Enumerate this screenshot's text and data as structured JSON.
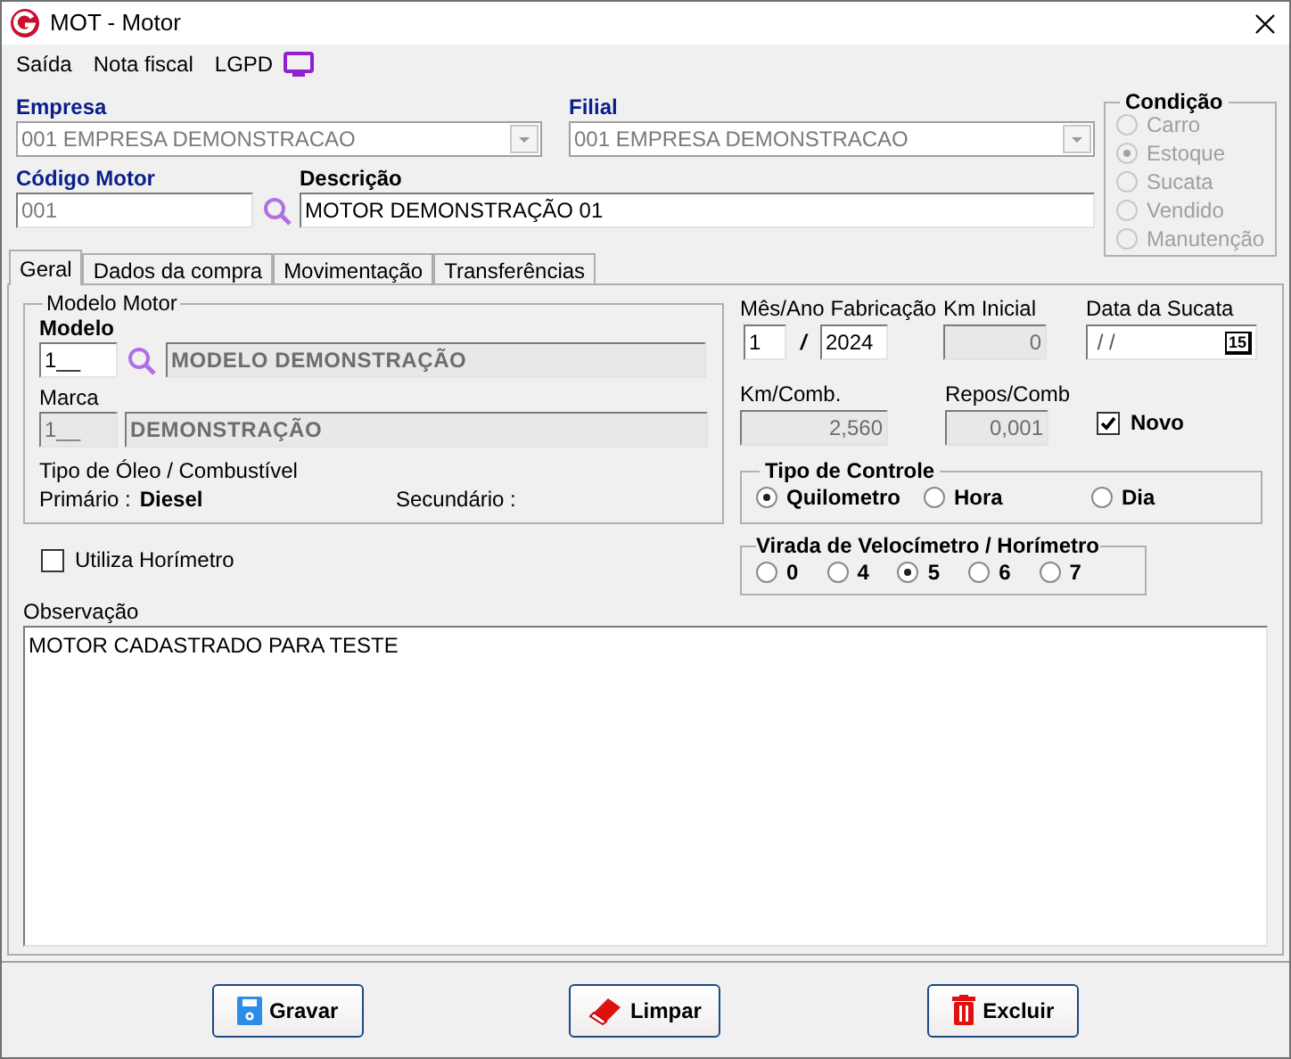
{
  "window": {
    "title": "MOT - Motor"
  },
  "menu": [
    {
      "label": "Saída"
    },
    {
      "label": "Nota fiscal"
    },
    {
      "label": "LGPD"
    }
  ],
  "empresa": {
    "label": "Empresa",
    "value": "001 EMPRESA DEMONSTRACAO"
  },
  "filial": {
    "label": "Filial",
    "value": "001 EMPRESA DEMONSTRACAO"
  },
  "codigo": {
    "label": "Código Motor",
    "value": "001"
  },
  "descricao": {
    "label": "Descrição",
    "value": "MOTOR DEMONSTRAÇÃO 01"
  },
  "condicao": {
    "title": "Condição",
    "disabled": true,
    "options": [
      {
        "label": "Carro",
        "selected": false
      },
      {
        "label": "Estoque",
        "selected": true
      },
      {
        "label": "Sucata",
        "selected": false
      },
      {
        "label": "Vendido",
        "selected": false
      },
      {
        "label": "Manutenção",
        "selected": false
      }
    ]
  },
  "tabs": [
    {
      "label": "Geral",
      "selected": true
    },
    {
      "label": "Dados da compra",
      "selected": false
    },
    {
      "label": "Movimentação",
      "selected": false
    },
    {
      "label": "Transferências",
      "selected": false
    }
  ],
  "modelo_motor": {
    "title": "Modelo Motor",
    "modelo": {
      "label": "Modelo",
      "code": "1__",
      "name": "MODELO DEMONSTRAÇÃO"
    },
    "marca": {
      "label": "Marca",
      "code": "1__",
      "name": "DEMONSTRAÇÃO"
    },
    "oleo_label": "Tipo de Óleo / Combustível",
    "primario": {
      "label": "Primário :",
      "value": "Diesel"
    },
    "secundario": {
      "label": "Secundário :"
    }
  },
  "utiliza_horimetro": {
    "label": "Utiliza Horímetro",
    "checked": false
  },
  "fabricacao": {
    "label": "Mês/Ano Fabricação",
    "month": "1",
    "separator": "/",
    "year": "2024"
  },
  "km_inicial": {
    "label": "Km Inicial",
    "value": "0"
  },
  "data_sucata": {
    "label": "Data da Sucata",
    "value": " / /",
    "calendar_day": "15"
  },
  "km_comb": {
    "label": "Km/Comb.",
    "value": "2,560"
  },
  "repos_comb": {
    "label": "Repos/Comb",
    "value": "0,001"
  },
  "novo": {
    "label": "Novo",
    "checked": true
  },
  "tipo_controle": {
    "title": "Tipo de Controle",
    "options": [
      {
        "label": "Quilometro",
        "selected": true
      },
      {
        "label": "Hora",
        "selected": false
      },
      {
        "label": "Dia",
        "selected": false
      }
    ]
  },
  "virada": {
    "title": "Virada de Velocímetro / Horímetro",
    "options": [
      {
        "label": "0",
        "selected": false
      },
      {
        "label": "4",
        "selected": false
      },
      {
        "label": "5",
        "selected": true
      },
      {
        "label": "6",
        "selected": false
      },
      {
        "label": "7",
        "selected": false
      }
    ]
  },
  "observacao": {
    "label": "Observação",
    "value": "MOTOR CADASTRADO PARA TESTE"
  },
  "buttons": [
    {
      "label": "Gravar",
      "kind": "save"
    },
    {
      "label": "Limpar",
      "kind": "clear"
    },
    {
      "label": "Excluir",
      "kind": "delete"
    }
  ]
}
